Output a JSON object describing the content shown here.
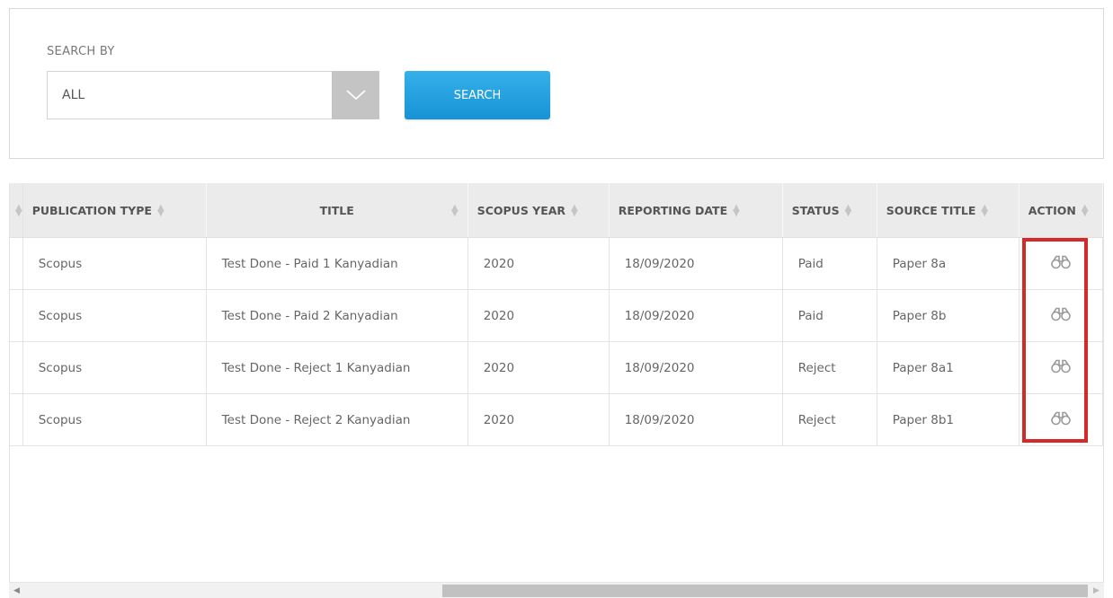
{
  "search": {
    "label": "SEARCH BY",
    "selected": "ALL",
    "button_label": "SEARCH"
  },
  "table": {
    "columns": [
      "PUBLICATION TYPE",
      "TITLE",
      "SCOPUS YEAR",
      "REPORTING DATE",
      "STATUS",
      "SOURCE TITLE",
      "ACTION"
    ],
    "rows": [
      {
        "publication_type": "Scopus",
        "title": "Test Done - Paid 1 Kanyadian",
        "scopus_year": "2020",
        "reporting_date": "18/09/2020",
        "status": "Paid",
        "source_title": "Paper 8a"
      },
      {
        "publication_type": "Scopus",
        "title": "Test Done - Paid 2 Kanyadian",
        "scopus_year": "2020",
        "reporting_date": "18/09/2020",
        "status": "Paid",
        "source_title": "Paper 8b"
      },
      {
        "publication_type": "Scopus",
        "title": "Test Done - Reject 1 Kanyadian",
        "scopus_year": "2020",
        "reporting_date": "18/09/2020",
        "status": "Reject",
        "source_title": "Paper 8a1"
      },
      {
        "publication_type": "Scopus",
        "title": "Test Done - Reject 2 Kanyadian",
        "scopus_year": "2020",
        "reporting_date": "18/09/2020",
        "status": "Reject",
        "source_title": "Paper 8b1"
      }
    ],
    "action_icon": "binoculars-icon"
  },
  "colors": {
    "button_blue": "#1793d6",
    "highlight_red": "#d42a2a",
    "header_bg": "#ebebeb"
  }
}
